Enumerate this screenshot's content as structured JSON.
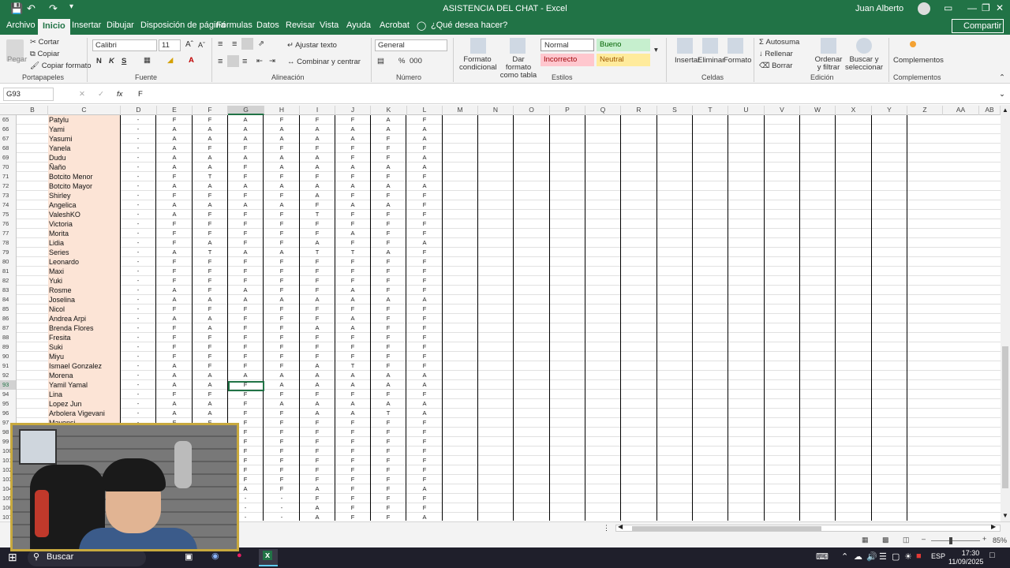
{
  "window": {
    "title": "ASISTENCIA DEL CHAT  -  Excel",
    "user": "Juan Alberto"
  },
  "tabs": [
    "Archivo",
    "Inicio",
    "Insertar",
    "Dibujar",
    "Disposición de página",
    "Fórmulas",
    "Datos",
    "Revisar",
    "Vista",
    "Ayuda",
    "Acrobat"
  ],
  "tell_me": "¿Qué desea hacer?",
  "share_label": "Compartir",
  "ribbon": {
    "clipboard": {
      "paste": "Pegar",
      "cut": "Cortar",
      "copy": "Copiar",
      "format_painter": "Copiar formato",
      "label": "Portapapeles"
    },
    "font": {
      "name": "Calibri",
      "size": "11",
      "bold": "N",
      "italic": "K",
      "underline": "S",
      "label": "Fuente"
    },
    "alignment": {
      "wrap": "Ajustar texto",
      "merge": "Combinar y centrar",
      "label": "Alineación"
    },
    "number": {
      "format": "General",
      "percent": "%",
      "thousands": "000",
      "label": "Número"
    },
    "styles": {
      "conditional": "Formato condicional",
      "table": "Dar formato como tabla",
      "normal": "Normal",
      "good": "Bueno",
      "bad": "Incorrecto",
      "neutral": "Neutral",
      "label": "Estilos"
    },
    "cells": {
      "insert": "Insertar",
      "delete": "Eliminar",
      "format": "Formato",
      "label": "Celdas"
    },
    "editing": {
      "autosum": "Autosuma",
      "fill": "Rellenar",
      "clear": "Borrar",
      "sort": "Ordenar y filtrar",
      "find": "Buscar y seleccionar",
      "label": "Edición"
    },
    "addins": {
      "btn": "Complementos",
      "label": "Complementos"
    }
  },
  "formula_bar": {
    "name_box": "G93",
    "value": "F",
    "fx": "fx"
  },
  "columns": [
    "B",
    "C",
    "D",
    "E",
    "F",
    "G",
    "H",
    "I",
    "J",
    "K",
    "L",
    "M",
    "N",
    "O",
    "P",
    "Q",
    "R",
    "S",
    "T",
    "U",
    "V",
    "W",
    "X",
    "Y",
    "Z",
    "AA",
    "AB"
  ],
  "rows": [
    {
      "n": "65",
      "name": "Patylu",
      "v": [
        "-",
        "F",
        "F",
        "A",
        "F",
        "F",
        "F",
        "A",
        "F"
      ]
    },
    {
      "n": "66",
      "name": "Yami",
      "v": [
        "-",
        "A",
        "A",
        "A",
        "A",
        "A",
        "A",
        "A",
        "A"
      ]
    },
    {
      "n": "67",
      "name": "Yasumi",
      "v": [
        "-",
        "A",
        "A",
        "A",
        "A",
        "A",
        "A",
        "F",
        "A"
      ]
    },
    {
      "n": "68",
      "name": "Yanela",
      "v": [
        "-",
        "A",
        "F",
        "F",
        "F",
        "F",
        "F",
        "F",
        "F"
      ]
    },
    {
      "n": "69",
      "name": "Dudu",
      "v": [
        "-",
        "A",
        "A",
        "A",
        "A",
        "A",
        "F",
        "F",
        "A"
      ]
    },
    {
      "n": "70",
      "name": "Ñaño",
      "v": [
        "-",
        "A",
        "A",
        "F",
        "A",
        "A",
        "A",
        "A",
        "A"
      ]
    },
    {
      "n": "71",
      "name": "Botcito Menor",
      "v": [
        "-",
        "F",
        "T",
        "F",
        "F",
        "F",
        "F",
        "F",
        "F"
      ]
    },
    {
      "n": "72",
      "name": "Botcito Mayor",
      "v": [
        "-",
        "A",
        "A",
        "A",
        "A",
        "A",
        "A",
        "A",
        "A"
      ]
    },
    {
      "n": "73",
      "name": "Shirley",
      "v": [
        "-",
        "F",
        "F",
        "F",
        "F",
        "A",
        "F",
        "F",
        "F"
      ]
    },
    {
      "n": "74",
      "name": "Angelica",
      "v": [
        "-",
        "A",
        "A",
        "A",
        "A",
        "F",
        "A",
        "A",
        "F"
      ]
    },
    {
      "n": "75",
      "name": "ValeshKO",
      "v": [
        "-",
        "A",
        "F",
        "F",
        "F",
        "T",
        "F",
        "F",
        "F"
      ]
    },
    {
      "n": "76",
      "name": "Victoria",
      "v": [
        "-",
        "F",
        "F",
        "F",
        "F",
        "F",
        "F",
        "F",
        "F"
      ]
    },
    {
      "n": "77",
      "name": "Morita",
      "v": [
        "-",
        "F",
        "F",
        "F",
        "F",
        "F",
        "A",
        "F",
        "F"
      ]
    },
    {
      "n": "78",
      "name": "Lidia",
      "v": [
        "-",
        "F",
        "A",
        "F",
        "F",
        "A",
        "F",
        "F",
        "A"
      ]
    },
    {
      "n": "79",
      "name": "Series",
      "v": [
        "-",
        "A",
        "T",
        "A",
        "A",
        "T",
        "T",
        "A",
        "F"
      ]
    },
    {
      "n": "80",
      "name": "Leonardo",
      "v": [
        "-",
        "F",
        "F",
        "F",
        "F",
        "F",
        "F",
        "F",
        "F"
      ]
    },
    {
      "n": "81",
      "name": "Maxi",
      "v": [
        "-",
        "F",
        "F",
        "F",
        "F",
        "F",
        "F",
        "F",
        "F"
      ]
    },
    {
      "n": "82",
      "name": "Yuki",
      "v": [
        "-",
        "F",
        "F",
        "F",
        "F",
        "F",
        "F",
        "F",
        "F"
      ]
    },
    {
      "n": "83",
      "name": "Rosme",
      "v": [
        "-",
        "A",
        "F",
        "A",
        "F",
        "F",
        "A",
        "F",
        "F"
      ]
    },
    {
      "n": "84",
      "name": "Joselina",
      "v": [
        "-",
        "A",
        "A",
        "A",
        "A",
        "A",
        "A",
        "A",
        "A"
      ]
    },
    {
      "n": "85",
      "name": "Nicol",
      "v": [
        "-",
        "F",
        "F",
        "F",
        "F",
        "F",
        "F",
        "F",
        "F"
      ]
    },
    {
      "n": "86",
      "name": "Andrea Arpi",
      "v": [
        "-",
        "A",
        "A",
        "F",
        "F",
        "F",
        "A",
        "F",
        "F"
      ]
    },
    {
      "n": "87",
      "name": "Brenda Flores",
      "v": [
        "-",
        "F",
        "A",
        "F",
        "F",
        "A",
        "A",
        "F",
        "F"
      ]
    },
    {
      "n": "88",
      "name": "Fresita",
      "v": [
        "-",
        "F",
        "F",
        "F",
        "F",
        "F",
        "F",
        "F",
        "F"
      ]
    },
    {
      "n": "89",
      "name": "Suki",
      "v": [
        "-",
        "F",
        "F",
        "F",
        "F",
        "F",
        "F",
        "F",
        "F"
      ]
    },
    {
      "n": "90",
      "name": "Miyu",
      "v": [
        "-",
        "F",
        "F",
        "F",
        "F",
        "F",
        "F",
        "F",
        "F"
      ]
    },
    {
      "n": "91",
      "name": "Ismael Gonzalez",
      "v": [
        "-",
        "A",
        "F",
        "F",
        "F",
        "A",
        "T",
        "F",
        "F"
      ]
    },
    {
      "n": "92",
      "name": "Morena",
      "v": [
        "-",
        "A",
        "A",
        "A",
        "A",
        "A",
        "A",
        "A",
        "A"
      ]
    },
    {
      "n": "93",
      "name": "Yamil Yamal",
      "v": [
        "-",
        "A",
        "A",
        "F",
        "A",
        "A",
        "A",
        "A",
        "A"
      ]
    },
    {
      "n": "94",
      "name": "Lina",
      "v": [
        "-",
        "F",
        "F",
        "F",
        "F",
        "F",
        "F",
        "F",
        "F"
      ]
    },
    {
      "n": "95",
      "name": "Lopez Jun",
      "v": [
        "-",
        "A",
        "A",
        "F",
        "A",
        "A",
        "A",
        "A",
        "A"
      ]
    },
    {
      "n": "96",
      "name": "Arbolera Vigevani",
      "v": [
        "-",
        "A",
        "A",
        "F",
        "F",
        "A",
        "A",
        "T",
        "A"
      ]
    },
    {
      "n": "97",
      "name": "Mayensi",
      "v": [
        "-",
        "F",
        "F",
        "F",
        "F",
        "F",
        "F",
        "F",
        "F"
      ]
    },
    {
      "n": "98",
      "name": "",
      "v": [
        "",
        "",
        "",
        "F",
        "F",
        "F",
        "F",
        "F",
        "F"
      ]
    },
    {
      "n": "99",
      "name": "",
      "v": [
        "",
        "",
        "",
        "F",
        "F",
        "F",
        "F",
        "F",
        "F"
      ]
    },
    {
      "n": "100",
      "name": "",
      "v": [
        "",
        "",
        "",
        "F",
        "F",
        "F",
        "F",
        "F",
        "F"
      ]
    },
    {
      "n": "101",
      "name": "",
      "v": [
        "",
        "",
        "",
        "F",
        "F",
        "F",
        "F",
        "F",
        "F"
      ]
    },
    {
      "n": "102",
      "name": "",
      "v": [
        "",
        "",
        "",
        "F",
        "F",
        "F",
        "F",
        "F",
        "F"
      ]
    },
    {
      "n": "103",
      "name": "",
      "v": [
        "",
        "",
        "",
        "F",
        "F",
        "F",
        "F",
        "F",
        "F"
      ]
    },
    {
      "n": "104",
      "name": "",
      "v": [
        "",
        "",
        "",
        "A",
        "F",
        "A",
        "F",
        "F",
        "A"
      ]
    },
    {
      "n": "105",
      "name": "",
      "v": [
        "",
        "",
        "",
        "-",
        "-",
        "F",
        "F",
        "F",
        "F"
      ]
    },
    {
      "n": "106",
      "name": "",
      "v": [
        "",
        "",
        "",
        "-",
        "-",
        "A",
        "F",
        "F",
        "F"
      ]
    },
    {
      "n": "107",
      "name": "",
      "v": [
        "",
        "",
        "",
        "-",
        "-",
        "A",
        "F",
        "F",
        "A"
      ]
    }
  ],
  "status": {
    "zoom": "85%"
  },
  "taskbar": {
    "search": "Buscar",
    "lang": "ESP",
    "time": "17:30",
    "date": "11/09/2025"
  },
  "colors": {
    "excel_green": "#217346",
    "name_fill": "#fce4d6"
  }
}
